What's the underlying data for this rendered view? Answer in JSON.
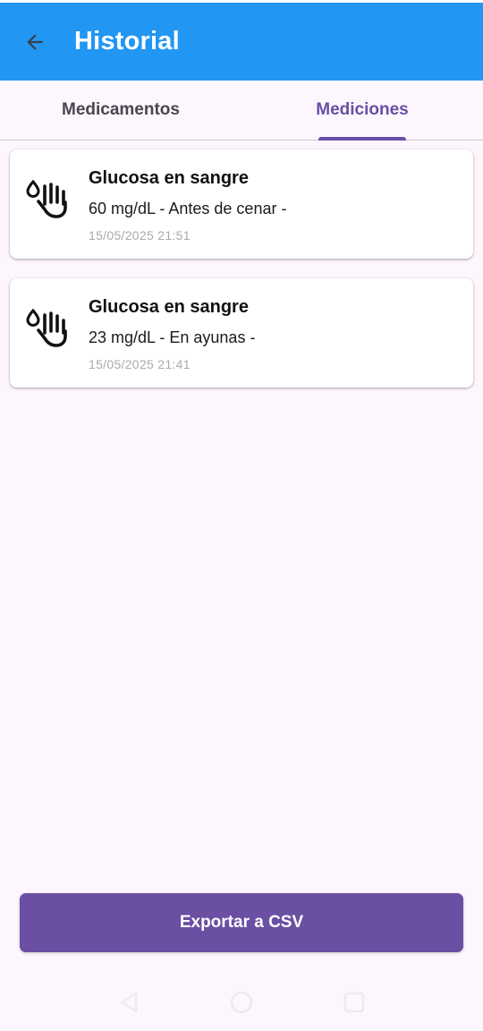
{
  "app_bar": {
    "title": "Historial",
    "back_icon": "arrow-left-icon",
    "color": "#2196f3"
  },
  "tabs": [
    {
      "label": "Medicamentos",
      "active": false
    },
    {
      "label": "Mediciones",
      "active": true
    }
  ],
  "measurements": [
    {
      "icon": "finger-prick-blood-drop-icon",
      "title": "Glucosa en sangre",
      "value": "60 mg/dL - Antes de cenar -",
      "date": "15/05/2025 21:51"
    },
    {
      "icon": "finger-prick-blood-drop-icon",
      "title": "Glucosa en sangre",
      "value": "23 mg/dL - En ayunas -",
      "date": "15/05/2025 21:41"
    }
  ],
  "export_button": {
    "label": "Exportar a CSV",
    "color": "#6a4fa3"
  },
  "accent_color": "#6750a4",
  "navigation": [
    "back-triangle-icon",
    "home-circle-icon",
    "recents-square-icon"
  ]
}
